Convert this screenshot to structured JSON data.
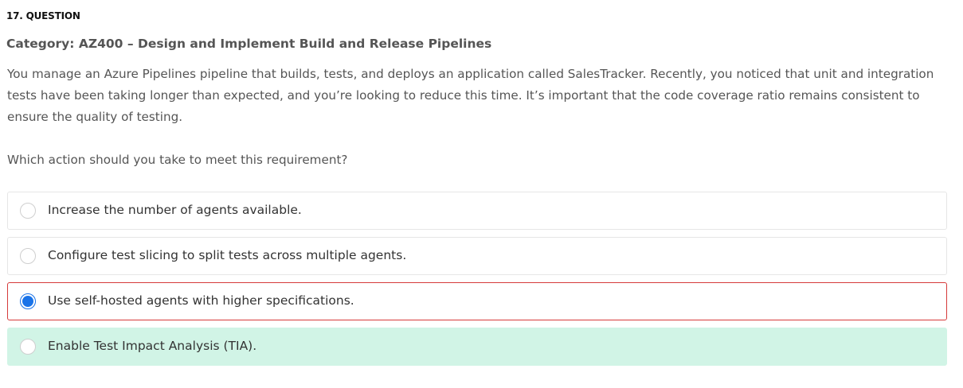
{
  "question": {
    "number_label": "17. QUESTION",
    "category": "Category: AZ400 – Design and Implement Build and Release Pipelines",
    "body": "You manage an Azure Pipelines pipeline that builds, tests, and deploys an application called SalesTracker. Recently, you noticed that unit and integration tests have been taking longer than expected, and you’re looking to reduce this time. It’s important that the code coverage ratio remains consistent to ensure the quality of testing.",
    "prompt": "Which action should you take to meet this requirement?"
  },
  "options": [
    {
      "label": "Increase the number of agents available.",
      "selected": false,
      "correct": false
    },
    {
      "label": "Configure test slicing to split tests across multiple agents.",
      "selected": false,
      "correct": false
    },
    {
      "label": "Use self-hosted agents with higher specifications.",
      "selected": true,
      "correct": false
    },
    {
      "label": "Enable Test Impact Analysis (TIA).",
      "selected": false,
      "correct": true
    }
  ],
  "colors": {
    "selected_wrong_border": "#d63a3a",
    "correct_background": "#d1f4e6",
    "radio_checked": "#1a73e8"
  },
  "icons": {
    "unchecked": "radio-unchecked-icon",
    "checked": "radio-checked-icon"
  }
}
